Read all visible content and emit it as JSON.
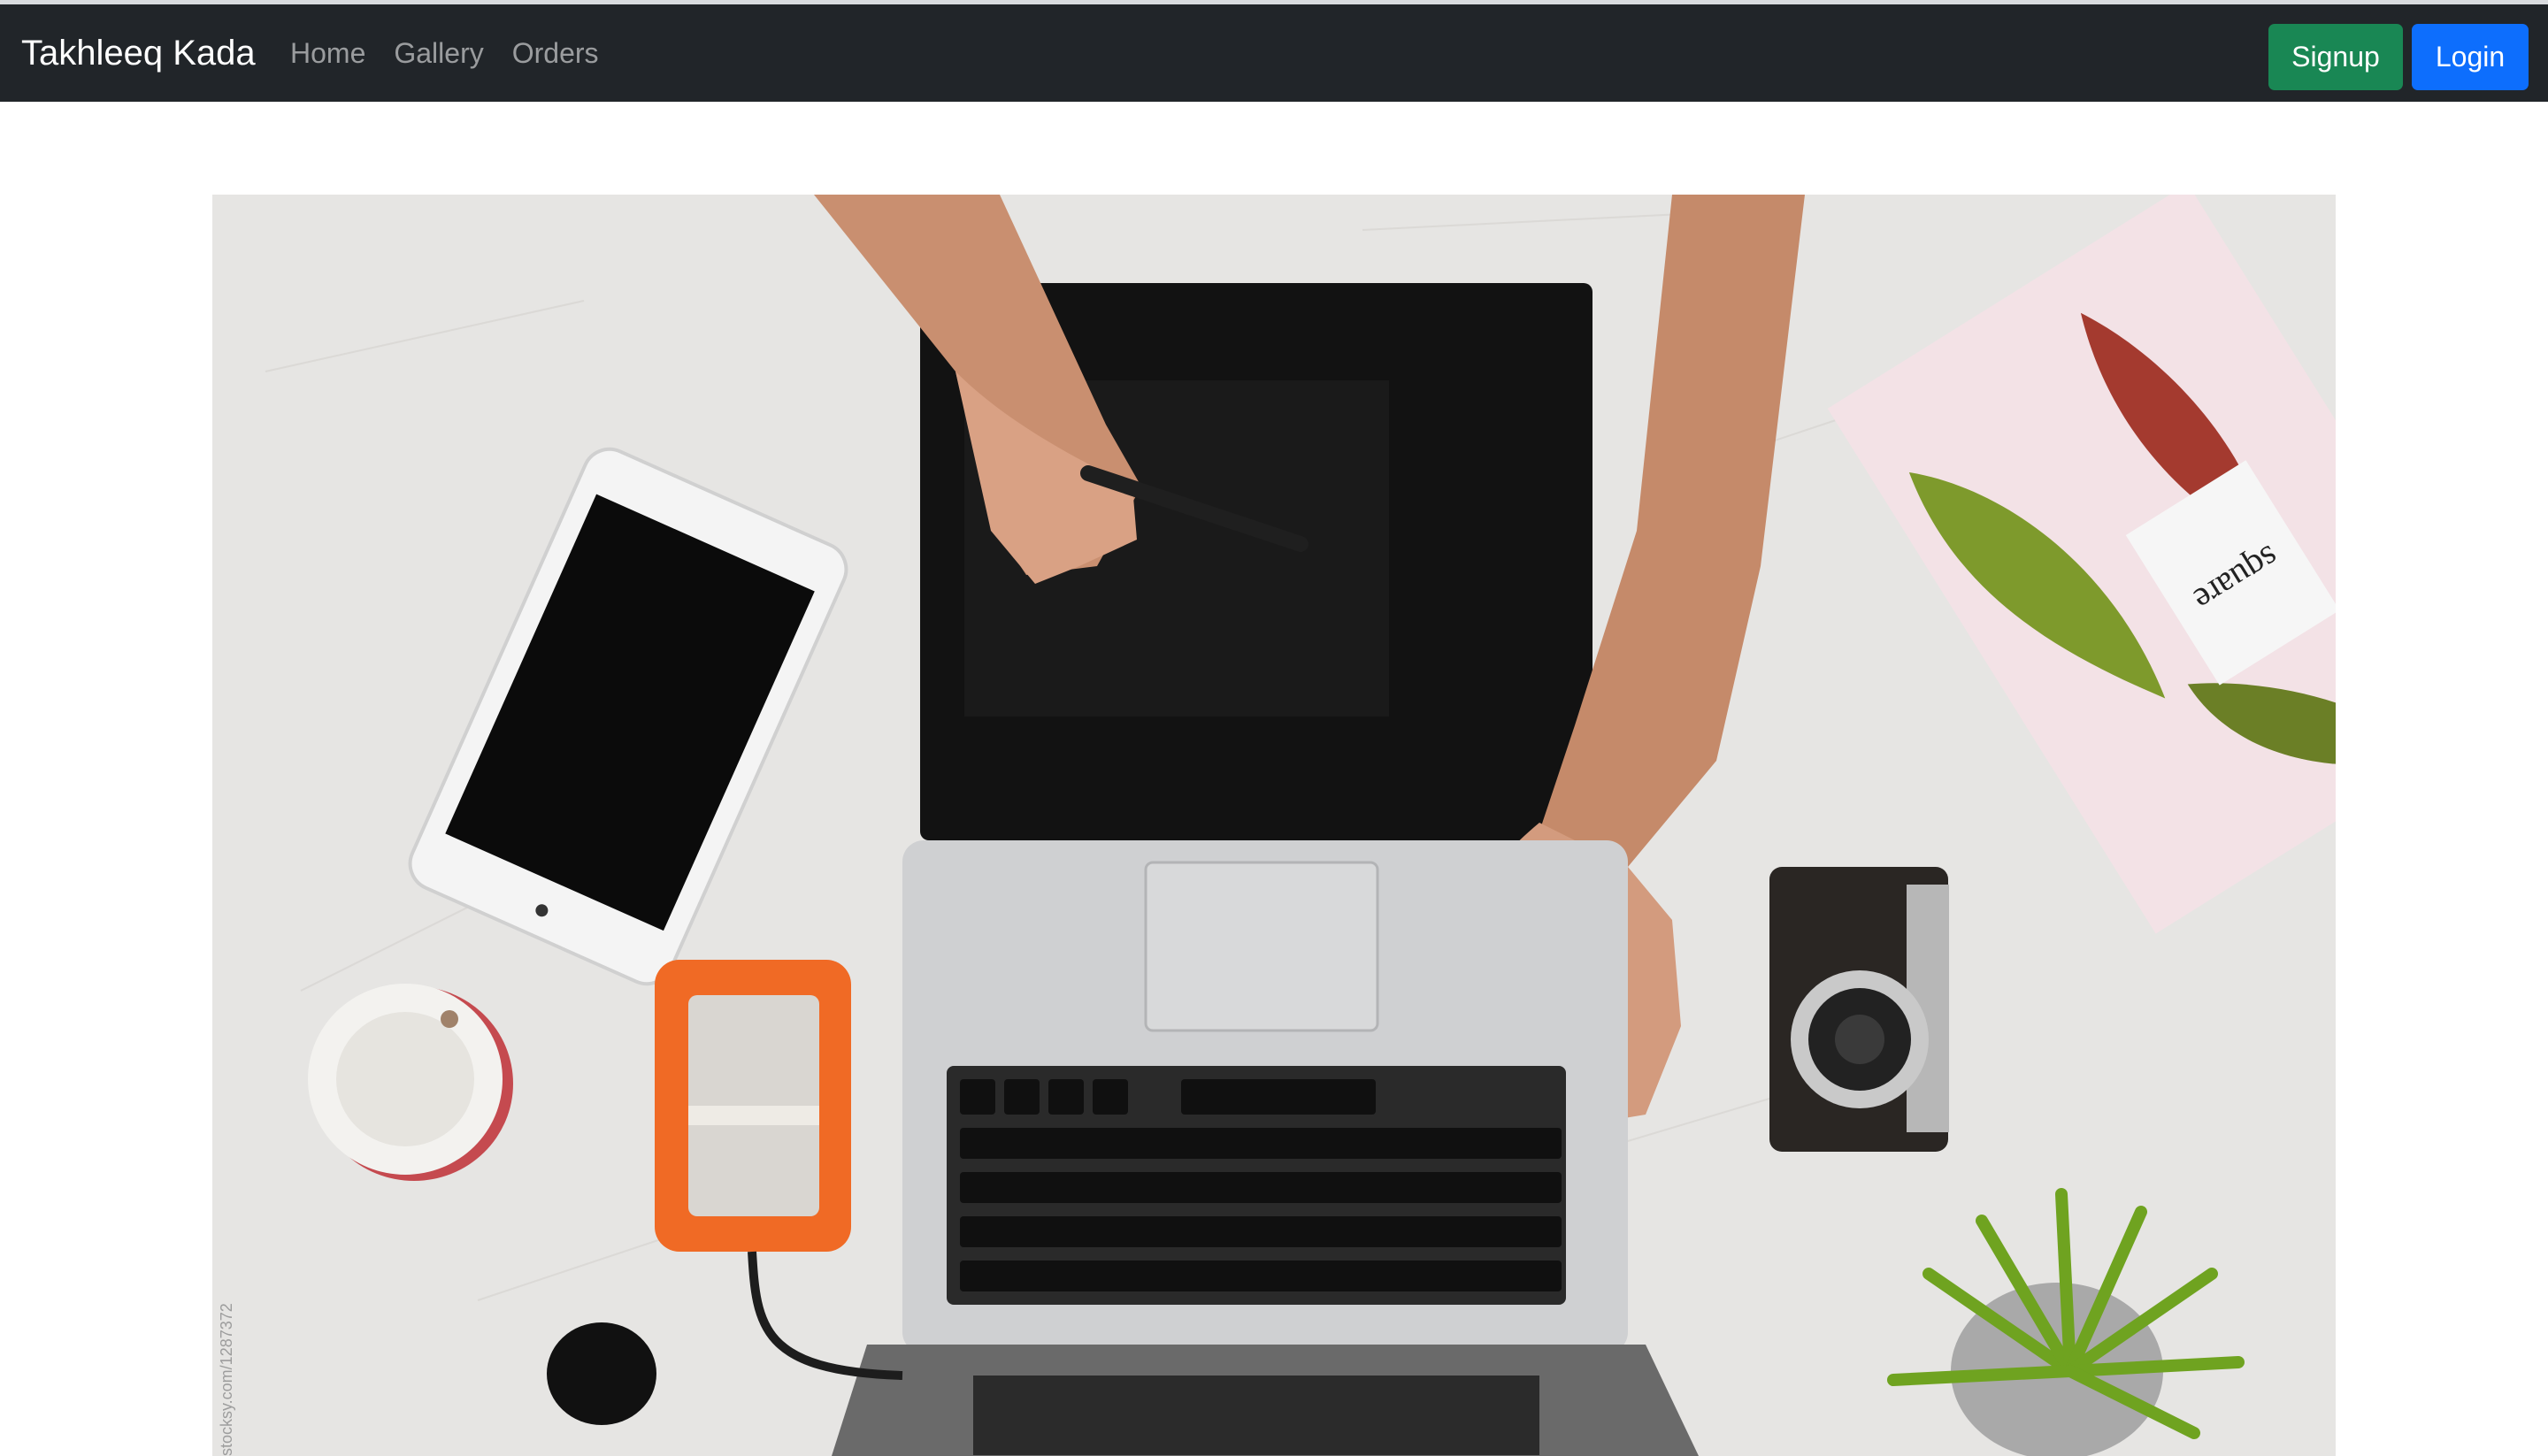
{
  "navbar": {
    "brand": "Takhleeq Kada",
    "links": [
      {
        "label": "Home"
      },
      {
        "label": "Gallery"
      },
      {
        "label": "Orders"
      }
    ],
    "signup_label": "Signup",
    "login_label": "Login"
  },
  "hero": {
    "scene_text": "square",
    "watermark_text": "stocksy.com/1287372"
  },
  "colors": {
    "navbar_bg": "#212529",
    "signup_bg": "#198754",
    "login_bg": "#0d6efd",
    "desk": "#e4e3e2"
  }
}
